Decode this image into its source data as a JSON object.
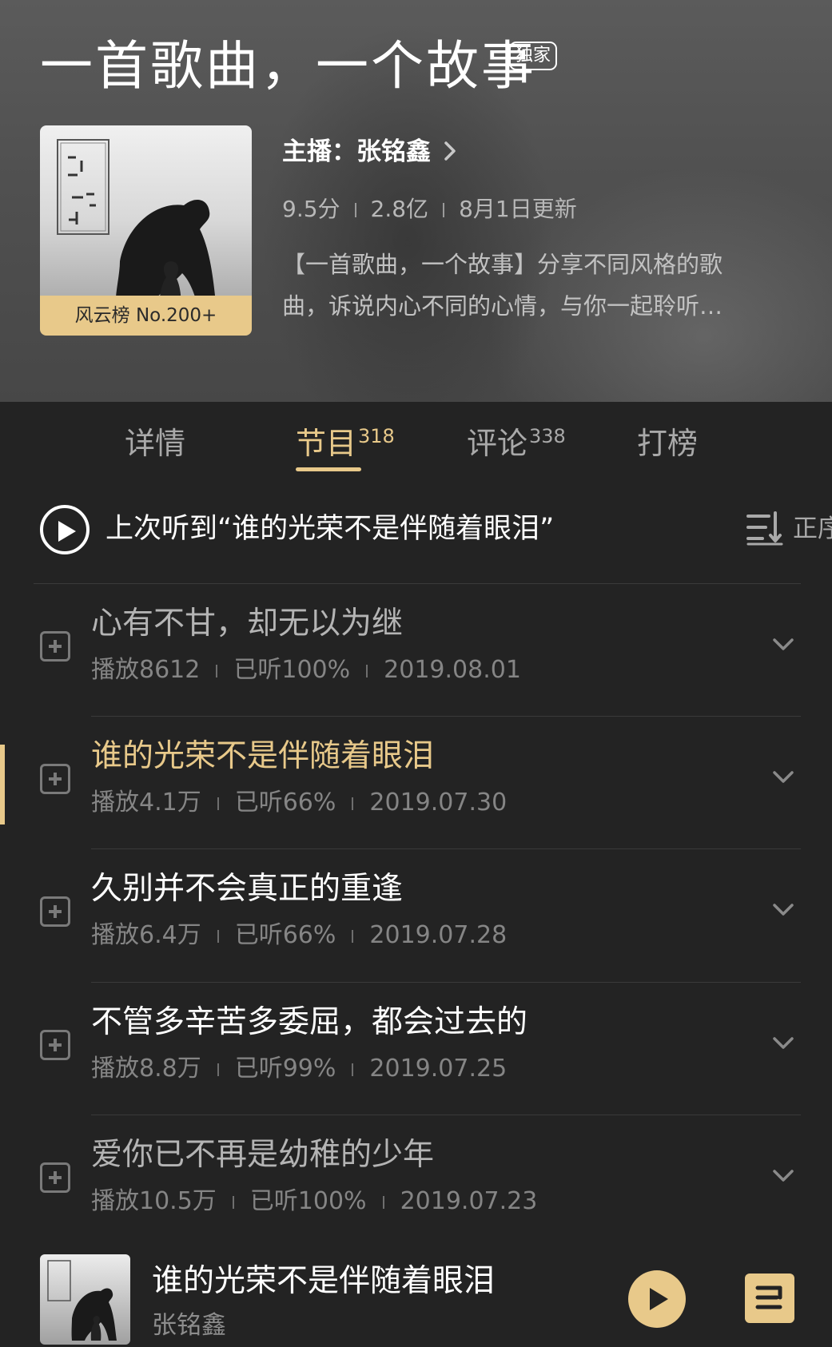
{
  "header": {
    "title": "一首歌曲，一个故事",
    "exclusive_badge": "独家",
    "rank_badge": "风云榜 No.200+",
    "anchor_label": "主播：张铭鑫",
    "stats": {
      "score": "9.5分",
      "plays": "2.8亿",
      "updated": "8月1日更新"
    },
    "description_line1": "【一首歌曲，一个故事】分享不同风格的歌",
    "description_line2": "曲，诉说内心不同的心情，与你一起聆听…"
  },
  "tabs": [
    {
      "label": "详情",
      "count": ""
    },
    {
      "label": "节目",
      "count": "318"
    },
    {
      "label": "评论",
      "count": "338"
    },
    {
      "label": "打榜",
      "count": ""
    }
  ],
  "active_tab": "节目",
  "last_played": {
    "text": "上次听到“谁的光荣不是伴随着眼泪”",
    "sort_label": "正序"
  },
  "episodes": [
    {
      "title": "心有不甘，却无以为继",
      "plays": "播放8612",
      "progress": "已听100%",
      "date": "2019.08.01",
      "state": "listened"
    },
    {
      "title": "谁的光荣不是伴随着眼泪",
      "plays": "播放4.1万",
      "progress": "已听66%",
      "date": "2019.07.30",
      "state": "playing"
    },
    {
      "title": "久别并不会真正的重逢",
      "plays": "播放6.4万",
      "progress": "已听66%",
      "date": "2019.07.28",
      "state": "normal"
    },
    {
      "title": "不管多辛苦多委屈，都会过去的",
      "plays": "播放8.8万",
      "progress": "已听99%",
      "date": "2019.07.25",
      "state": "normal"
    },
    {
      "title": "爱你已不再是幼稚的少年",
      "plays": "播放10.5万",
      "progress": "已听100%",
      "date": "2019.07.23",
      "state": "listened"
    }
  ],
  "player": {
    "title": "谁的光荣不是伴随着眼泪",
    "artist": "张铭鑫"
  },
  "colors": {
    "accent": "#e8c98a",
    "background": "#232323",
    "header_bg": "#505050"
  },
  "icons": [
    "chevron-right-icon",
    "play-circle-icon",
    "sort-icon",
    "add-to-playlist-icon",
    "chevron-down-icon",
    "play-icon",
    "playlist-icon"
  ]
}
